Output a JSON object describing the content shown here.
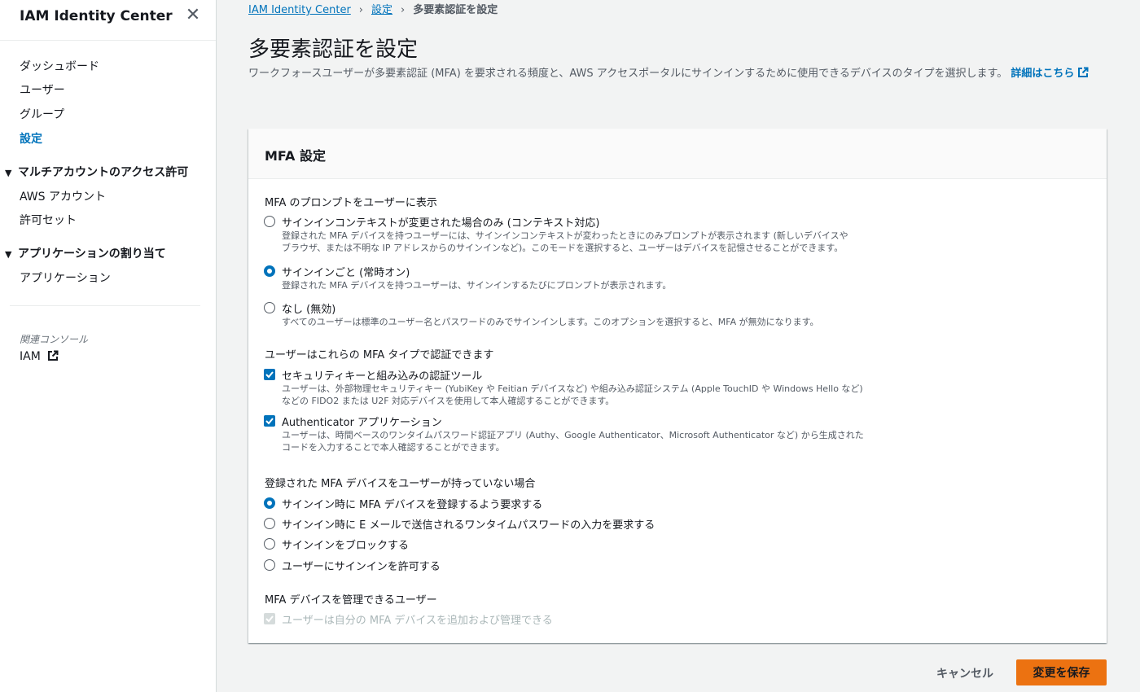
{
  "sidebar": {
    "title": "IAM Identity Center",
    "close_glyph": "✕",
    "items": [
      {
        "label": "ダッシュボード"
      },
      {
        "label": "ユーザー"
      },
      {
        "label": "グループ"
      },
      {
        "label": "設定",
        "active": true
      }
    ],
    "sections": [
      {
        "label": "マルチアカウントのアクセス許可",
        "items": [
          {
            "label": "AWS アカウント"
          },
          {
            "label": "許可セット"
          }
        ]
      },
      {
        "label": "アプリケーションの割り当て",
        "items": [
          {
            "label": "アプリケーション"
          }
        ]
      }
    ],
    "related_label": "関連コンソール",
    "related_iam": "IAM",
    "triangle": "▼"
  },
  "breadcrumb": {
    "items": [
      "IAM Identity Center",
      "設定",
      "多要素認証を設定"
    ],
    "separator": "›"
  },
  "page": {
    "title": "多要素認証を設定",
    "description": "ワークフォースユーザーが多要素認証 (MFA) を要求される頻度と、AWS アクセスポータルにサインインするために使用できるデバイスのタイプを選択します。",
    "learn_more": "詳細はこちら"
  },
  "panel": {
    "title": "MFA 設定",
    "prompt_group": {
      "label": "MFA のプロンプトをユーザーに表示",
      "options": [
        {
          "title": "サインインコンテキストが変更された場合のみ (コンテキスト対応)",
          "desc": [
            "登録された MFA デバイスを持つユーザーには、サインインコンテキストが変わったときにのみプロンプトが表示されます (新しいデバイスや",
            "ブラウザ、または不明な IP アドレスからのサインインなど)。このモードを選択すると、ユーザーはデバイスを記憶させることができます。"
          ],
          "checked": false
        },
        {
          "title": "サインインごと (常時オン)",
          "desc": [
            "登録された MFA デバイスを持つユーザーは、サインインするたびにプロンプトが表示されます。"
          ],
          "checked": true
        },
        {
          "title": "なし (無効)",
          "desc": [
            "すべてのユーザーは標準のユーザー名とパスワードのみでサインインします。このオプションを選択すると、MFA が無効になります。"
          ],
          "checked": false
        }
      ]
    },
    "type_group": {
      "label": "ユーザーはこれらの MFA タイプで認証できます",
      "options": [
        {
          "title": "セキュリティキーと組み込みの認証ツール",
          "desc": [
            "ユーザーは、外部物理セキュリティキー (YubiKey や Feitian デバイスなど) や組み込み認証システム (Apple TouchID や Windows Hello など)",
            "などの FIDO2 または U2F 対応デバイスを使用して本人確認することができます。"
          ],
          "checked": true
        },
        {
          "title": "Authenticator アプリケーション",
          "desc": [
            "ユーザーは、時間ベースのワンタイムパスワード認証アプリ (Authy、Google Authenticator、Microsoft Authenticator など) から生成された",
            "コードを入力することで本人確認することができます。"
          ],
          "checked": true
        }
      ]
    },
    "no_device_group": {
      "label": "登録された MFA デバイスをユーザーが持っていない場合",
      "options": [
        {
          "title": "サインイン時に MFA デバイスを登録するよう要求する",
          "checked": true
        },
        {
          "title": "サインイン時に E メールで送信されるワンタイムパスワードの入力を要求する",
          "checked": false
        },
        {
          "title": "サインインをブロックする",
          "checked": false
        },
        {
          "title": "ユーザーにサインインを許可する",
          "checked": false
        }
      ]
    },
    "manage_group": {
      "label": "MFA デバイスを管理できるユーザー",
      "option": {
        "title": "ユーザーは自分の MFA デバイスを追加および管理できる",
        "checked": true,
        "disabled": true
      }
    }
  },
  "footer": {
    "cancel_label": "キャンセル",
    "save_label": "変更を保存"
  },
  "colors": {
    "link": "#0073bb",
    "primary_button": "#ec7211",
    "background": "#f2f3f3"
  },
  "icons": {
    "external_link": "external-link-icon",
    "close": "close-icon",
    "check": "check-icon"
  }
}
